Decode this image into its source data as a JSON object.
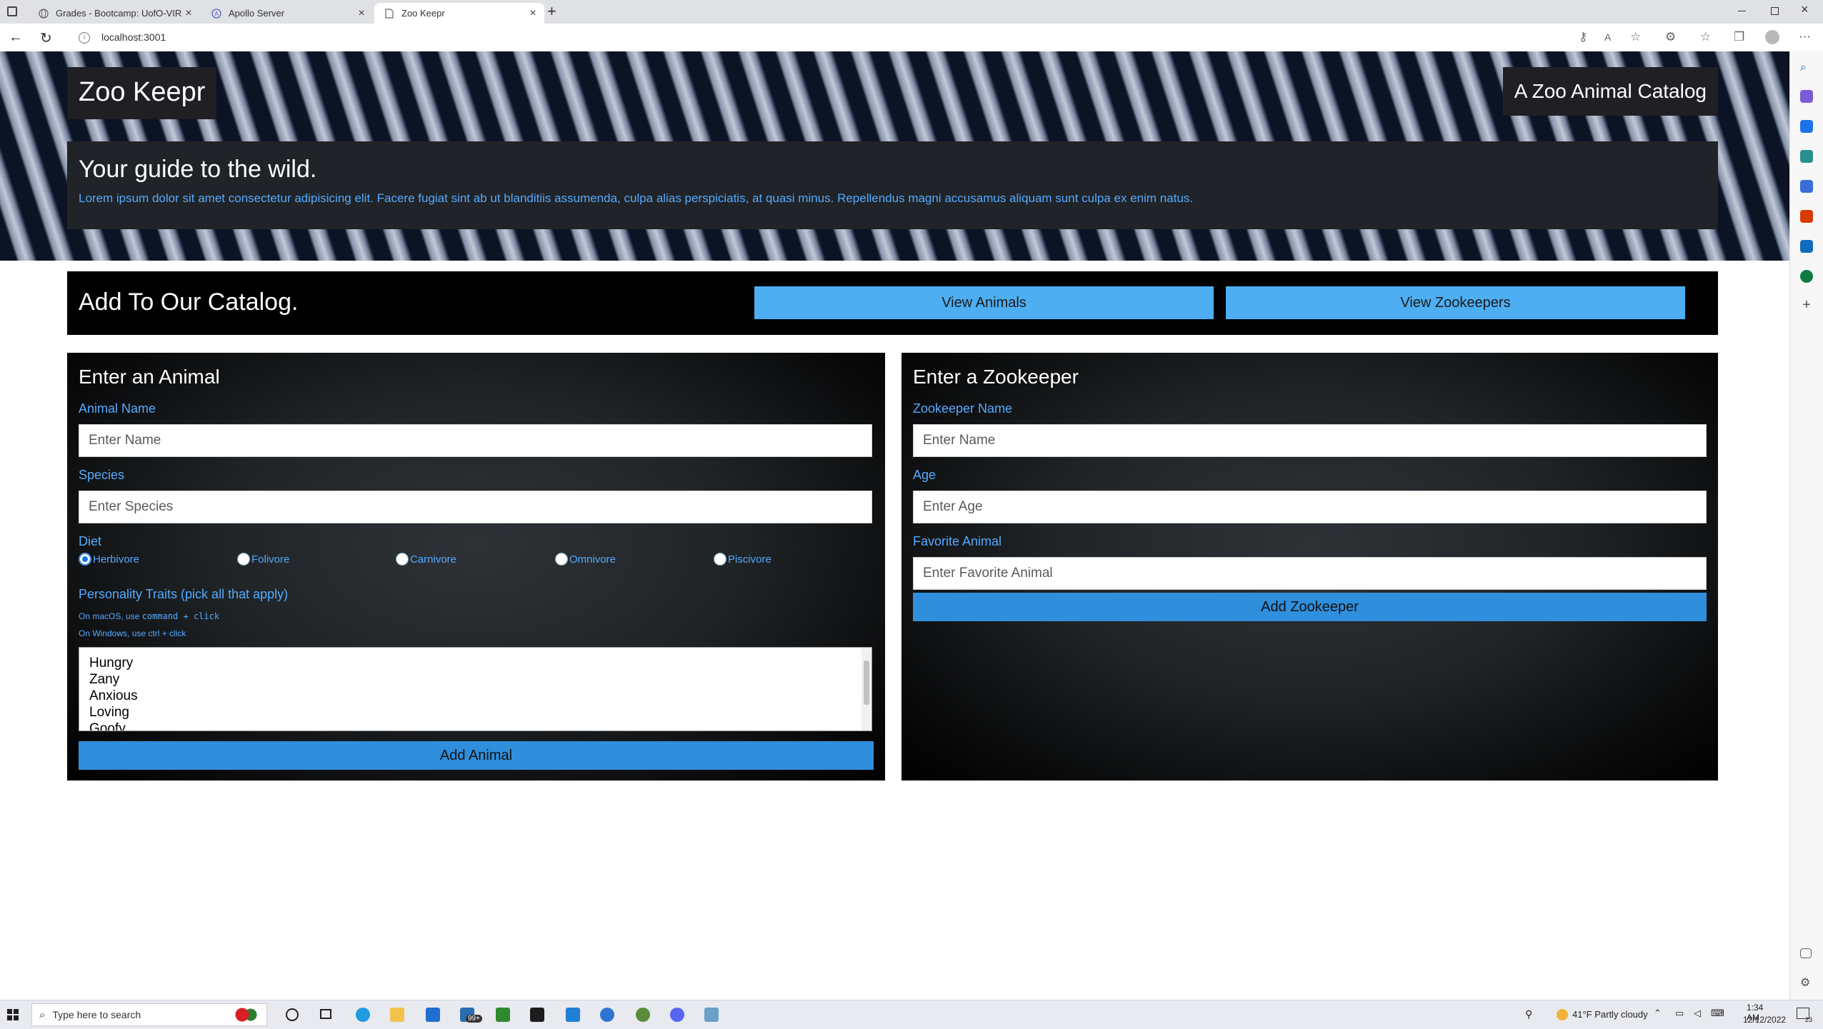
{
  "browser": {
    "tabs": [
      {
        "title": "Grades - Bootcamp: UofO-VIRT-",
        "active": false
      },
      {
        "title": "Apollo Server",
        "active": false
      },
      {
        "title": "Zoo Keepr",
        "active": true
      }
    ],
    "new_tab_label": "+",
    "url": "localhost:3001"
  },
  "header": {
    "brand": "Zoo Keepr",
    "tagline": "A Zoo Animal Catalog",
    "intro_title": "Your guide to the wild.",
    "intro_text": "Lorem ipsum dolor sit amet consectetur adipisicing elit. Facere fugiat sint ab ut blanditiis assumenda, culpa alias perspiciatis, at quasi minus. Repellendus magni accusamus aliquam sunt culpa ex enim natus."
  },
  "catalog": {
    "title": "Add To Our Catalog.",
    "view_animals": "View Animals",
    "view_zookeepers": "View Zookeepers"
  },
  "animal_form": {
    "heading": "Enter an Animal",
    "name_label": "Animal Name",
    "name_placeholder": "Enter Name",
    "species_label": "Species",
    "species_placeholder": "Enter Species",
    "diet_label": "Diet",
    "diets": [
      "Herbivore",
      "Folivore",
      "Carnivore",
      "Omnivore",
      "Piscivore"
    ],
    "selected_diet": "Herbivore",
    "traits_label": "Personality Traits (pick all that apply)",
    "hint_mac_prefix": "On macOS, use ",
    "hint_mac_code": "command + click",
    "hint_windows": "On Windows, use ctrl + click",
    "traits": [
      "Hungry",
      "Zany",
      "Anxious",
      "Loving",
      "Goofy"
    ],
    "submit": "Add Animal"
  },
  "zookeeper_form": {
    "heading": "Enter a Zookeeper",
    "name_label": "Zookeeper Name",
    "name_placeholder": "Enter Name",
    "age_label": "Age",
    "age_placeholder": "Enter Age",
    "favorite_label": "Favorite Animal",
    "favorite_placeholder": "Enter Favorite Animal",
    "submit": "Add Zookeeper"
  },
  "taskbar": {
    "search_placeholder": "Type here to search",
    "badge": "99+",
    "weather": "41°F  Partly cloudy",
    "time": "1:34 AM",
    "date": "12/12/2022",
    "notification_count": "23"
  },
  "colors": {
    "accent_blue": "#55aaff",
    "button_blue": "#4eaef2",
    "submit_blue": "#2f8fdd",
    "panel_dark": "#202327"
  }
}
